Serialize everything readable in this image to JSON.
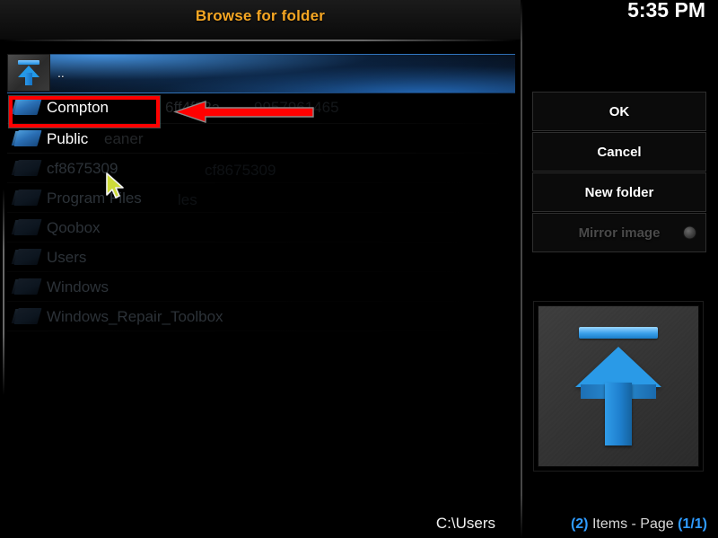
{
  "window": {
    "close_label": "×",
    "clock": "5:35 PM"
  },
  "dialog": {
    "title": "Browse for folder",
    "path": "C:\\Users",
    "status": {
      "count": "(2)",
      "items_text": " Items - Page ",
      "page": "(1/1)"
    }
  },
  "file_list": {
    "parent_entry": {
      "label": "..",
      "icon": "up-arrow-icon",
      "selected": true
    },
    "items": [
      {
        "label": "Compton",
        "icon": "folder-icon",
        "state": "active",
        "highlighted": true
      },
      {
        "label": "Public",
        "icon": "folder-icon",
        "state": "active"
      },
      {
        "label": "cf8675309",
        "icon": "folder-icon",
        "state": "fading"
      },
      {
        "label": "Program Files",
        "icon": "folder-icon",
        "state": "fading"
      },
      {
        "label": "Qoobox",
        "icon": "folder-icon",
        "state": "fading"
      },
      {
        "label": "Users",
        "icon": "folder-icon",
        "state": "fading"
      },
      {
        "label": "Windows",
        "icon": "folder-icon",
        "state": "fading"
      },
      {
        "label": "Windows_Repair_Toolbox",
        "icon": "folder-icon",
        "state": "fading"
      }
    ],
    "ghost_overlay": [
      "6ff4f82a",
      "9957961465",
      "eaner",
      "cf8675309",
      "les"
    ]
  },
  "buttons": [
    {
      "label": "OK",
      "name": "ok-button",
      "disabled": false
    },
    {
      "label": "Cancel",
      "name": "cancel-button",
      "disabled": false
    },
    {
      "label": "New folder",
      "name": "new-folder-button",
      "disabled": false
    },
    {
      "label": "Mirror image",
      "name": "mirror-image-button",
      "disabled": true,
      "toggle": true
    }
  ],
  "preview": {
    "icon": "up-arrow-thumbnail",
    "alt": "Parent directory"
  },
  "colors": {
    "title_orange": "#f5a623",
    "accent_blue": "#2f9bff",
    "annotation_red": "#ff0000",
    "background": "#000000"
  },
  "annotations": {
    "highlight_target": "Compton",
    "arrow_direction": "left"
  }
}
